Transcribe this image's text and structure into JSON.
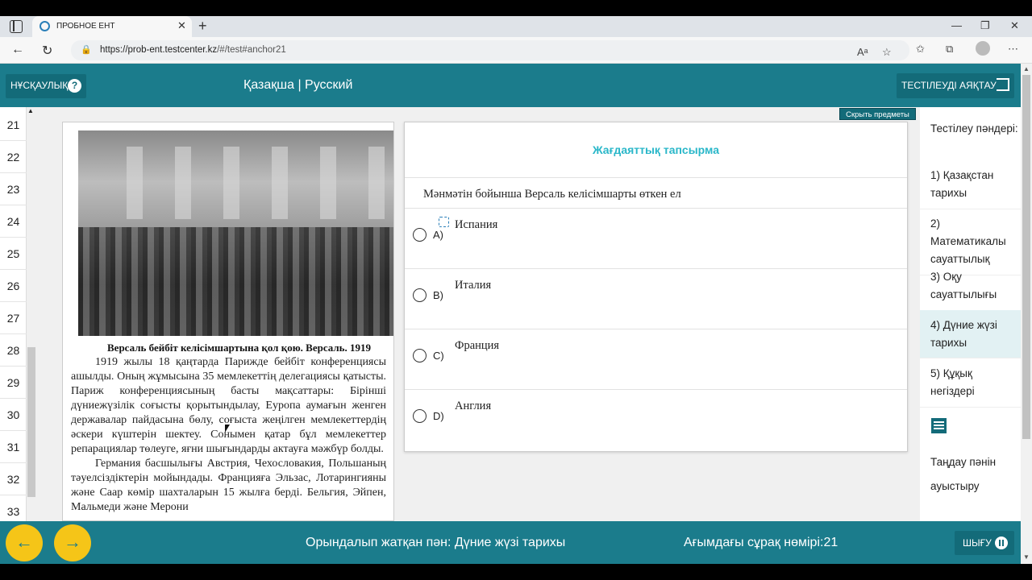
{
  "browser": {
    "tab_title": "ПРОБНОЕ ЕНТ",
    "url_host": "https://prob-ent.testcenter.kz",
    "url_path": "/#/test#anchor21"
  },
  "header": {
    "instructions_label": "НҰСҚАУЛЫҚ",
    "language_switch": "Қазақша | Русский",
    "end_test_label": "ТЕСТІЛЕУДІ АЯҚТАУ",
    "hide_subjects_label": "Скрыть предметы"
  },
  "question_numbers": [
    "21",
    "22",
    "23",
    "24",
    "25",
    "26",
    "27",
    "28",
    "29",
    "30",
    "31",
    "32",
    "33"
  ],
  "document": {
    "caption": "Версаль бейбіт келісімшартына қол қою. Версаль. 1919",
    "paragraphs": [
      "1919 жылы 18 қаңтарда Парижде бейбіт конференциясы ашылды. Оның жұмысына 35 мемлекеттің делегациясы қатысты. Париж конференциясының басты мақсаттары: Бірінші дүниежүзілік соғысты қорытындылау, Еуропа аумағын женген державалар пайдасына бөлу, соғыста жеңілген мемлекеттердің әскери күштерін шектеу. Сонымен қатар бұл мемлекеттер репарациялар төлеуге, яғни шығындарды актауға мәжбүр болды.",
      "Германия басшылығы Австрия, Чехословакия, Польшаның тәуелсіздіктерін мойындады. Францияға Эльзас, Лотарингияны және Саар көмір шахталарын 15 жылға берді. Бельгия, Эйпен, Мальмеди және Мерони"
    ]
  },
  "question": {
    "title": "Жағдаяттық тапсырма",
    "text": "Мәнмәтін бойынша Версаль келісімшарты өткен ел",
    "options": [
      {
        "letter": "A)",
        "text": "Испания"
      },
      {
        "letter": "B)",
        "text": "Италия"
      },
      {
        "letter": "C)",
        "text": "Франция"
      },
      {
        "letter": "D)",
        "text": "Англия"
      }
    ]
  },
  "subjects": {
    "heading": "Тестілеу пәндері:",
    "items": [
      {
        "label": "1) Қазақстан тарихы"
      },
      {
        "label": "2) Математикалы сауаттылық"
      },
      {
        "label": "3) Оқу сауаттылығы"
      },
      {
        "label": "4) Дүние жүзі тарихы"
      },
      {
        "label": "5) Құқық негіздері"
      }
    ],
    "active_index": 3,
    "switch_label": "Таңдау пәнін ауыстыру"
  },
  "footer": {
    "prev_arrow": "←",
    "next_arrow": "→",
    "current_subject": "Орындалып жатқан пән: Дүние жүзі тарихы",
    "current_question": "Ағымдағы сұрақ нөмірі:21",
    "exit_label": "ШЫҒУ"
  },
  "colors": {
    "header_bg": "#1b7c8c",
    "accent_teal": "#2ab7c9",
    "nav_button": "#f5c518"
  }
}
